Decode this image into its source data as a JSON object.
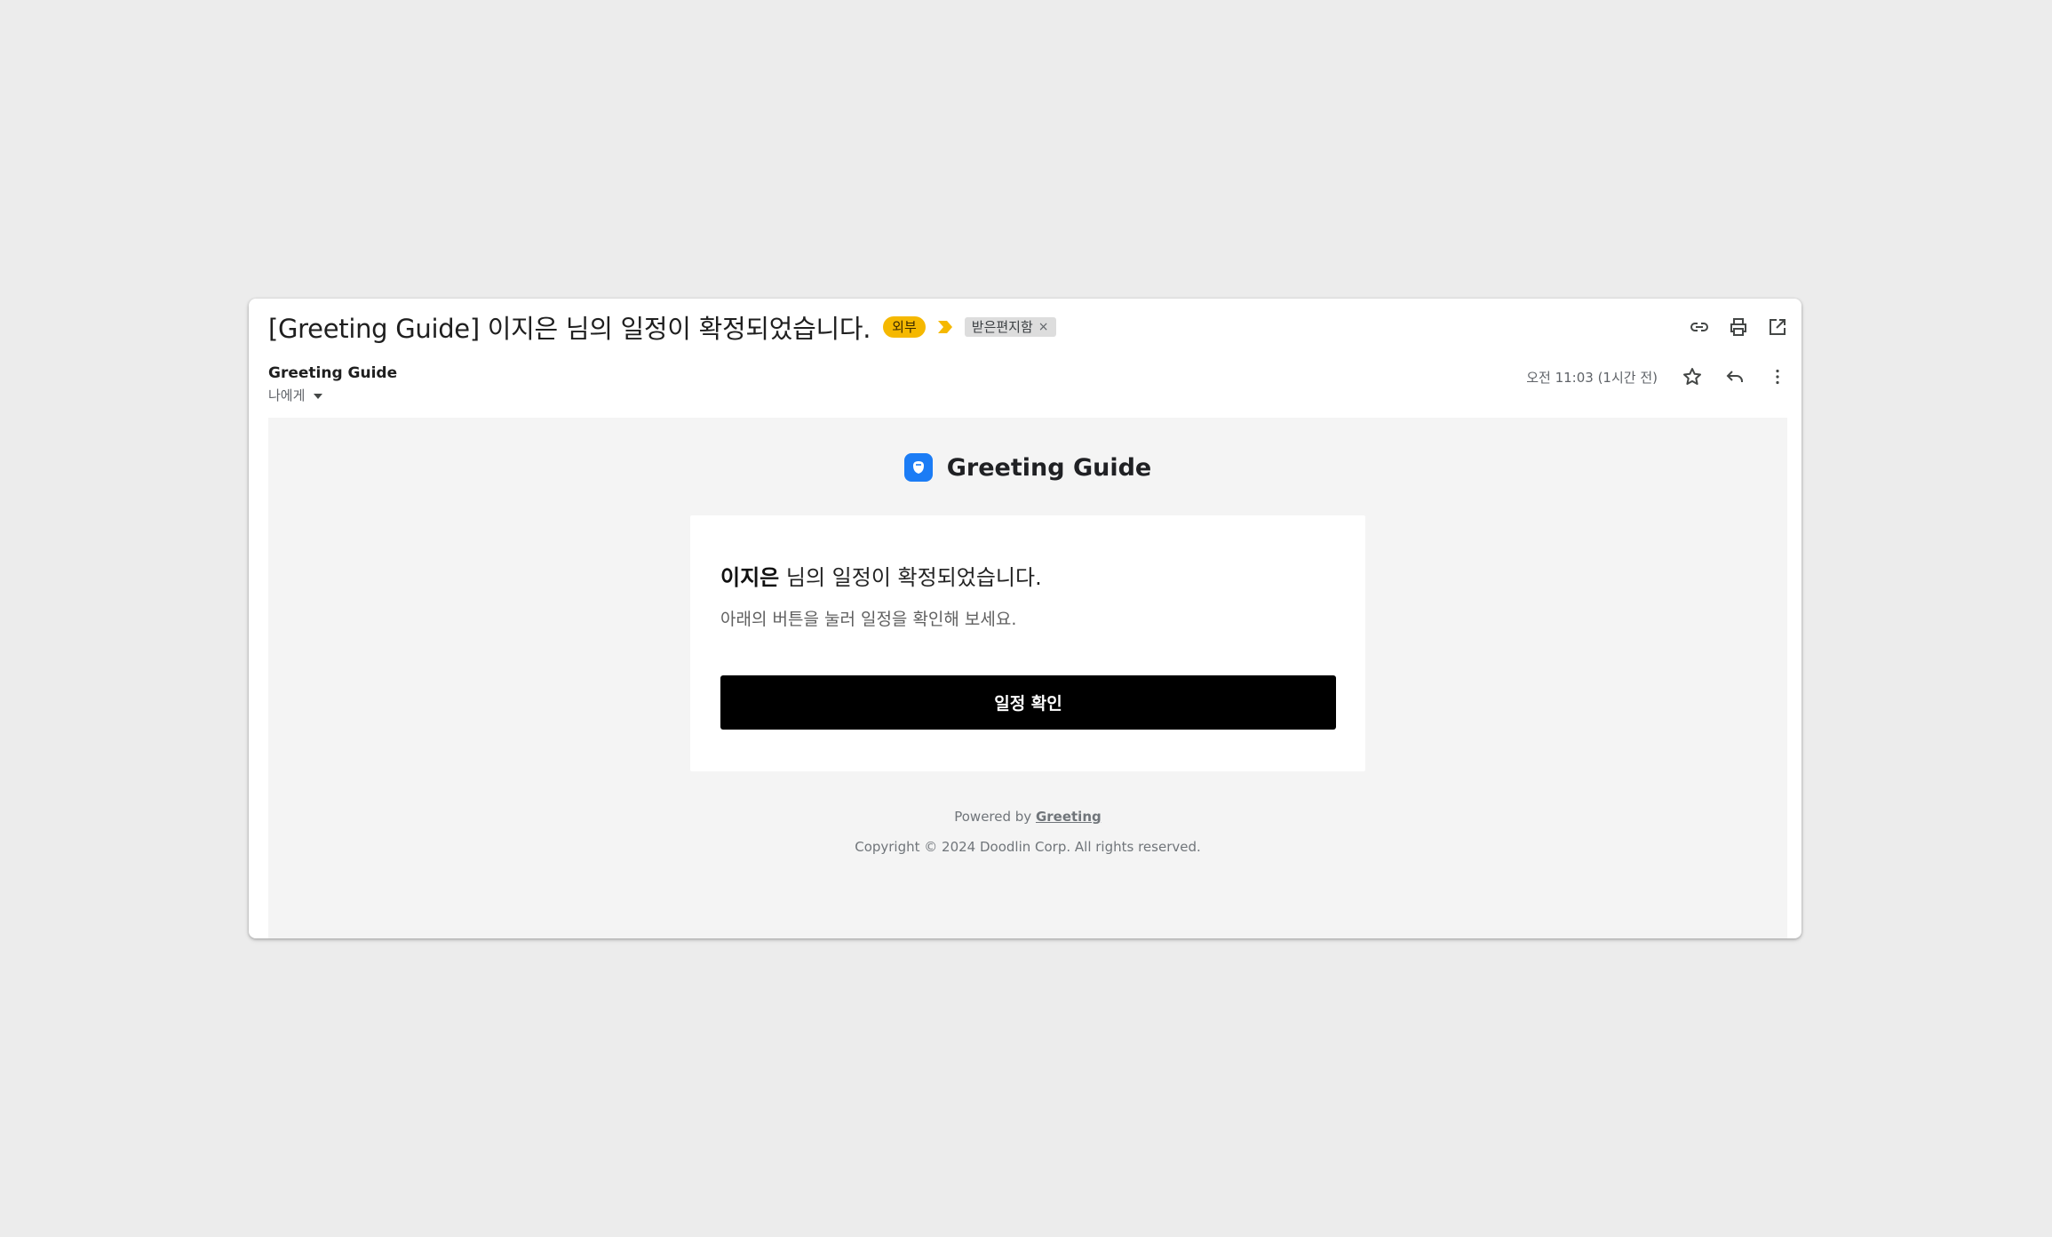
{
  "email": {
    "subject": "[Greeting Guide] 이지은 님의 일정이 확정되었습니다.",
    "external_tag": "외부",
    "label": "받은편지함",
    "label_remove": "×",
    "sender": "Greeting Guide",
    "recipient": "나에게",
    "timestamp": "오전 11:03 (1시간 전)"
  },
  "icons": {
    "top": [
      "link-icon",
      "print-icon",
      "open-in-new-icon"
    ],
    "meta": [
      "star-icon",
      "reply-icon",
      "more-vert-icon"
    ]
  },
  "body": {
    "brand_name": "Greeting Guide",
    "card": {
      "name": "이지은",
      "title_rest": " 님의 일정이 확정되었습니다.",
      "subtitle": "아래의 버튼을 눌러 일정을 확인해 보세요.",
      "button_label": "일정 확인"
    },
    "footer": {
      "powered_prefix": "Powered by ",
      "powered_link": "Greeting",
      "copyright": "Copyright © 2024 Doodlin Corp. All rights reserved."
    }
  },
  "colors": {
    "background": "#ececec",
    "external_tag": "#f5b800",
    "brand_blue": "#1b7cf5",
    "button": "#000000"
  }
}
